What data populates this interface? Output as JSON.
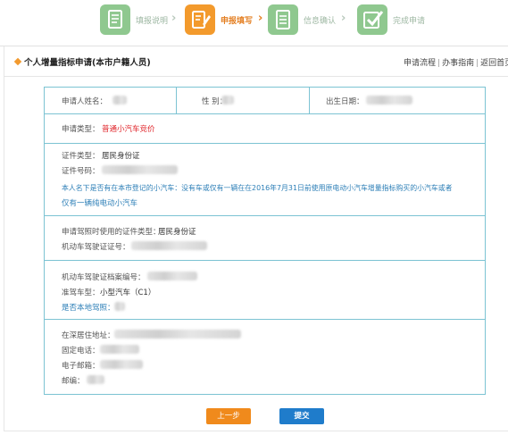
{
  "steps": [
    {
      "label": "填报说明",
      "icon": "document-icon",
      "color": "#8fc88f",
      "state": "done"
    },
    {
      "label": "申报填写",
      "icon": "edit-icon",
      "color": "#f39a2c",
      "state": "active"
    },
    {
      "label": "信息确认",
      "icon": "list-icon",
      "color": "#8fc88f",
      "state": "pending"
    },
    {
      "label": "完成申请",
      "icon": "check-icon",
      "color": "#8fc88f",
      "state": "pending"
    }
  ],
  "header": {
    "title": "个人增量指标申请(本市户籍人员)",
    "links": [
      "申请流程",
      "办事指南",
      "返回首页"
    ]
  },
  "form": {
    "applicant_name_label": "申请人姓名：",
    "gender_label": "性  别：",
    "birth_label": "出生日期：",
    "apply_type_label": "申请类型：",
    "apply_type_value": "普通小汽车竞价",
    "id_type_label": "证件类型：",
    "id_type_value": "居民身份证",
    "id_number_label": "证件号码：",
    "statement_line1": "本人名下是否有在本市登记的小汽车：没有车或仅有一辆在在2016年7月31日前使用原电动小汽车增量指标购买的小汽车或者",
    "statement_line2": "仅有一辆纯电动小汽车",
    "license_id_type_label": "申请驾照时使用的证件类型：",
    "license_id_type_value": "居民身份证",
    "license_number_label": "机动车驾驶证证号：",
    "license_file_label": "机动车驾驶证档案编号：",
    "vehicle_class_label": "准驾车型：",
    "vehicle_class_value": "小型汽车（C1）",
    "local_license_label": "是否本地驾照：",
    "address_label": "在深居住地址：",
    "phone_label": "固定电话：",
    "email_label": "电子邮箱：",
    "postcode_label": "邮编："
  },
  "buttons": {
    "prev_label": "上一步",
    "submit_label": "提交"
  },
  "colors": {
    "accent_orange": "#f08a1c",
    "submit_blue": "#1f7ccb",
    "table_border": "#7cc3d3",
    "step_green": "#8fc88f",
    "highlight_red": "#e0262b",
    "statement_blue": "#2d7fb7"
  }
}
